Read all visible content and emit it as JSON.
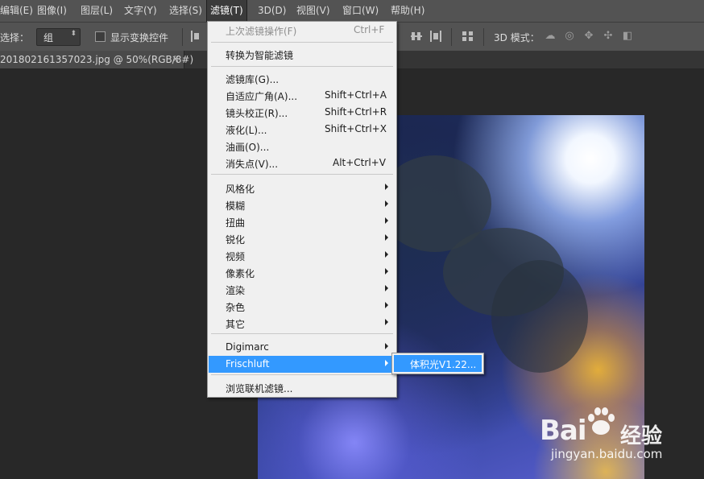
{
  "menubar": {
    "items": [
      "滤镜(E)",
      "图像(I)",
      "图层(L)",
      "文字(Y)",
      "选择(S)",
      "滤镜(T)",
      "3D(D)",
      "视图(V)",
      "窗口(W)",
      "帮助(H)"
    ],
    "first_label": "编辑(E)",
    "active": "滤镜(T)"
  },
  "options": {
    "auto_select_label": "选择：",
    "auto_select_value": "组",
    "show_transform_label": "显示变换控件",
    "mode_3d_label": "3D 模式："
  },
  "tab": {
    "title": "201802161357023.jpg @ 50%(RGB/8#)",
    "close": "×"
  },
  "filter_menu": {
    "last_filter": {
      "label": "上次滤镜操作(F)",
      "shortcut": "Ctrl+F"
    },
    "convert_smart": "转换为智能滤镜",
    "group1": [
      {
        "label": "滤镜库(G)...",
        "shortcut": ""
      },
      {
        "label": "自适应广角(A)...",
        "shortcut": "Shift+Ctrl+A"
      },
      {
        "label": "镜头校正(R)...",
        "shortcut": "Shift+Ctrl+R"
      },
      {
        "label": "液化(L)...",
        "shortcut": "Shift+Ctrl+X"
      },
      {
        "label": "油画(O)...",
        "shortcut": ""
      },
      {
        "label": "消失点(V)...",
        "shortcut": "Alt+Ctrl+V"
      }
    ],
    "submenus": [
      "风格化",
      "模糊",
      "扭曲",
      "锐化",
      "视频",
      "像素化",
      "渲染",
      "杂色",
      "其它"
    ],
    "plugins": [
      "Digimarc",
      "Frischluft"
    ],
    "browse_online": "浏览联机滤镜..."
  },
  "frischluft_submenu": {
    "item": "体积光V1.22..."
  },
  "watermark": {
    "brand": "Bai",
    "brand_cn": "经验",
    "url": "jingyan.baidu.com"
  },
  "colors": {
    "menu_highlight": "#3399ff",
    "menubar_bg": "#535353",
    "workspace_bg": "#282828"
  }
}
